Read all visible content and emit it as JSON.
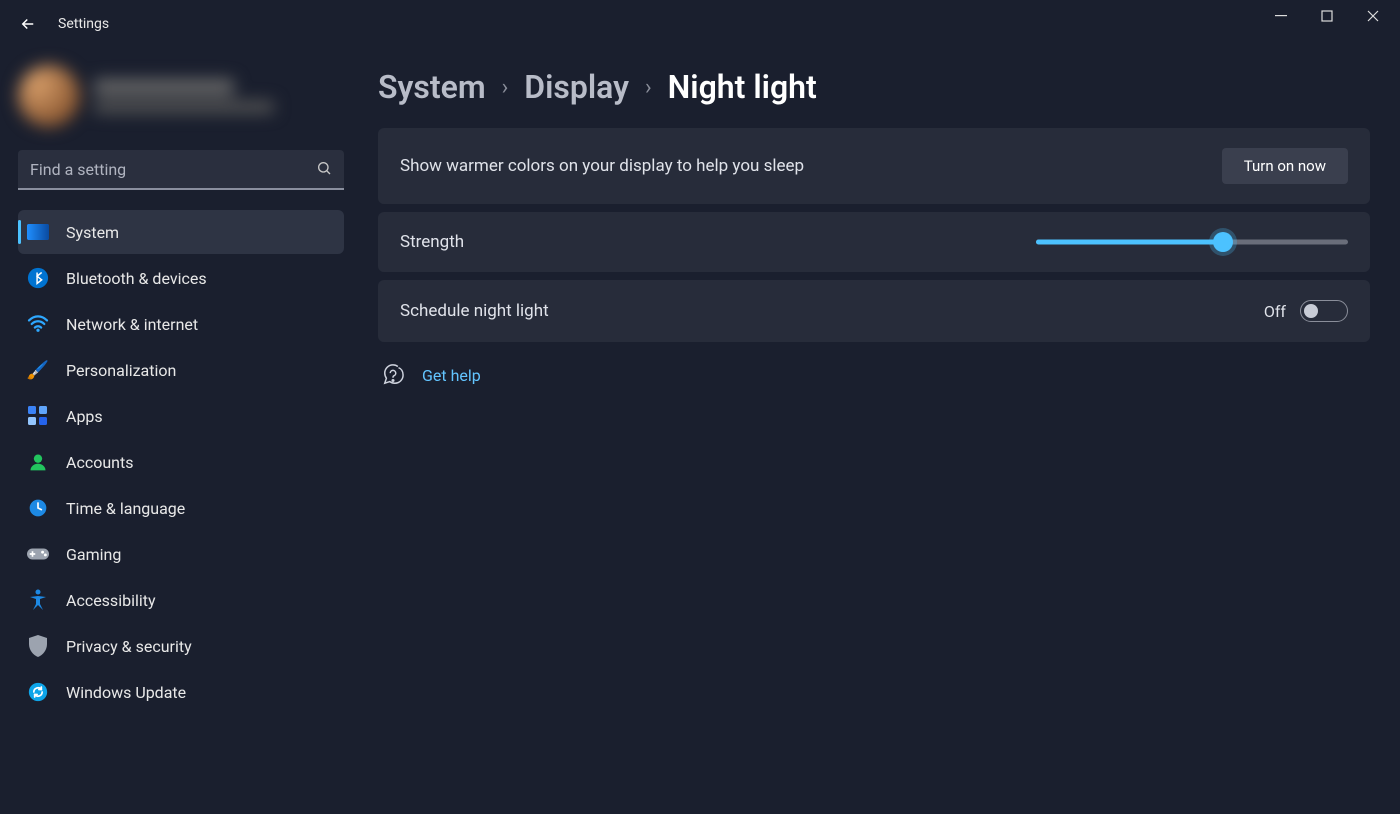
{
  "window": {
    "title": "Settings"
  },
  "search": {
    "placeholder": "Find a setting"
  },
  "sidebar": {
    "items": [
      {
        "label": "System",
        "icon": "🖥️",
        "active": true
      },
      {
        "label": "Bluetooth & devices",
        "icon": "ble",
        "active": false
      },
      {
        "label": "Network & internet",
        "icon": "wifi",
        "active": false
      },
      {
        "label": "Personalization",
        "icon": "🖌️",
        "active": false
      },
      {
        "label": "Apps",
        "icon": "apps",
        "active": false
      },
      {
        "label": "Accounts",
        "icon": "👤",
        "active": false
      },
      {
        "label": "Time & language",
        "icon": "🕒",
        "active": false
      },
      {
        "label": "Gaming",
        "icon": "🎮",
        "active": false
      },
      {
        "label": "Accessibility",
        "icon": "acc",
        "active": false
      },
      {
        "label": "Privacy & security",
        "icon": "🛡️",
        "active": false
      },
      {
        "label": "Windows Update",
        "icon": "🔄",
        "active": false
      }
    ]
  },
  "breadcrumbs": {
    "level0": "System",
    "level1": "Display",
    "level2": "Night light"
  },
  "cards": {
    "description": "Show warmer colors on your display to help you sleep",
    "turn_on_label": "Turn on now",
    "strength_label": "Strength",
    "strength_percent": 60,
    "schedule_label": "Schedule night light",
    "schedule_state": "Off"
  },
  "help": {
    "label": "Get help"
  }
}
